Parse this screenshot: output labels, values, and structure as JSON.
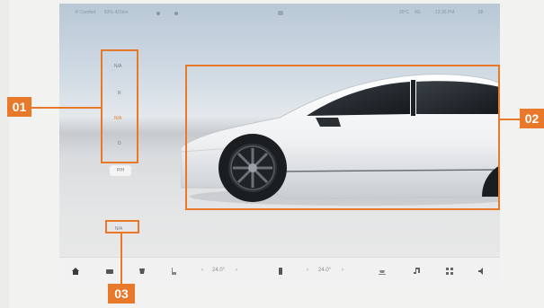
{
  "status_bar": {
    "left_items": [
      "P Comfort",
      "83% 421km"
    ],
    "right_items": [
      "28°C",
      "4G",
      "12:30 PM",
      "88"
    ]
  },
  "drive_modes": {
    "items": [
      {
        "label": "N/A"
      },
      {
        "label": "R"
      },
      {
        "label": "N/A",
        "active": true
      },
      {
        "label": "D"
      }
    ],
    "extra_label": "P/H"
  },
  "small_control": {
    "label": "N/A"
  },
  "dock": {
    "driver_temp": "24.0°",
    "passenger_temp": "24.0°",
    "icons": [
      "home-icon",
      "car-icon",
      "seat-heat-icon",
      "seat-icon",
      "fan-icon",
      "defrost-icon",
      "music-icon",
      "apps-icon",
      "volume-icon"
    ]
  },
  "callouts": {
    "label_01": "01",
    "label_02": "02",
    "label_03": "03"
  },
  "colors": {
    "accent": "#e8782a",
    "active_mode": "#e87722"
  }
}
